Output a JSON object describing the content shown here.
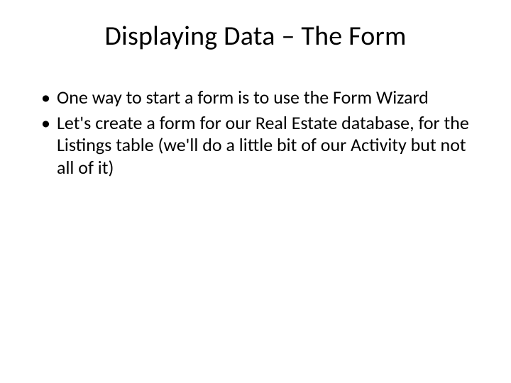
{
  "slide": {
    "title": "Displaying Data – The Form",
    "bullets": [
      "One way to start a form is to use the Form Wizard",
      "Let's create a form for our Real Estate database, for the Listings table (we'll do a little bit of our Activity but not all of it)"
    ]
  }
}
